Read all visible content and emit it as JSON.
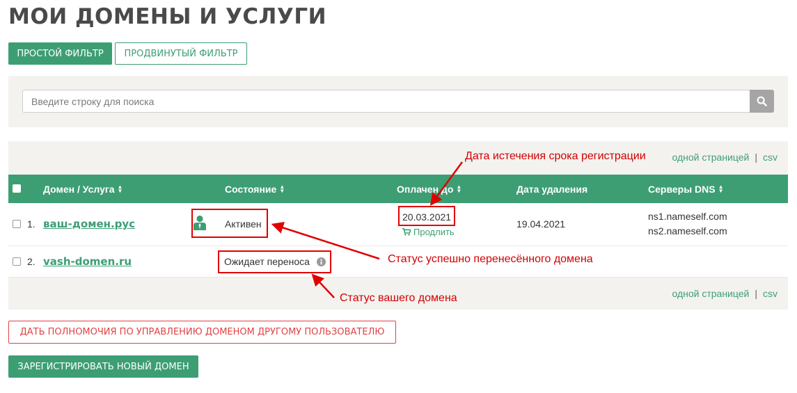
{
  "page_title": "МОИ ДОМЕНЫ И УСЛУГИ",
  "filters": {
    "simple_label": "ПРОСТОЙ ФИЛЬТР",
    "advanced_label": "ПРОДВИНУТЫЙ ФИЛЬТР"
  },
  "search": {
    "placeholder": "Введите строку для поиска",
    "icon": "search-icon"
  },
  "table_links": {
    "one_page": "одной страницей",
    "separator": "|",
    "csv": "csv"
  },
  "columns": {
    "domain": "Домен / Услуга",
    "status": "Состояние",
    "paid_until": "Оплачен до",
    "delete_date": "Дата удаления",
    "dns": "Серверы DNS"
  },
  "rows": [
    {
      "num": "1.",
      "domain": "ваш-домен.рус",
      "status": "Активен",
      "status_icon": "user-icon",
      "paid_until": "20.03.2021",
      "renew": "Продлить",
      "delete_date": "19.04.2021",
      "dns1": "ns1.nameself.com",
      "dns2": "ns2.nameself.com"
    },
    {
      "num": "2.",
      "domain": "vash-domen.ru",
      "status": "Ожидает переноса",
      "status_icon": "info-icon"
    }
  ],
  "annotations": {
    "expiry": "Дата истечения срока регистрации",
    "transferred": "Статус успешно перенесённого домена",
    "yours": "Статус вашего домена"
  },
  "actions": {
    "delegate_label": "ДАТЬ ПОЛНОМОЧИЯ ПО УПРАВЛЕНИЮ ДОМЕНОМ ДРУГОМУ ПОЛЬЗОВАТЕЛЮ",
    "register_label": "ЗАРЕГИСТРИРОВАТЬ НОВЫЙ ДОМЕН"
  },
  "colors": {
    "accent": "#3d9e74",
    "annotation": "#e00000",
    "panel": "#f4f2ef"
  }
}
